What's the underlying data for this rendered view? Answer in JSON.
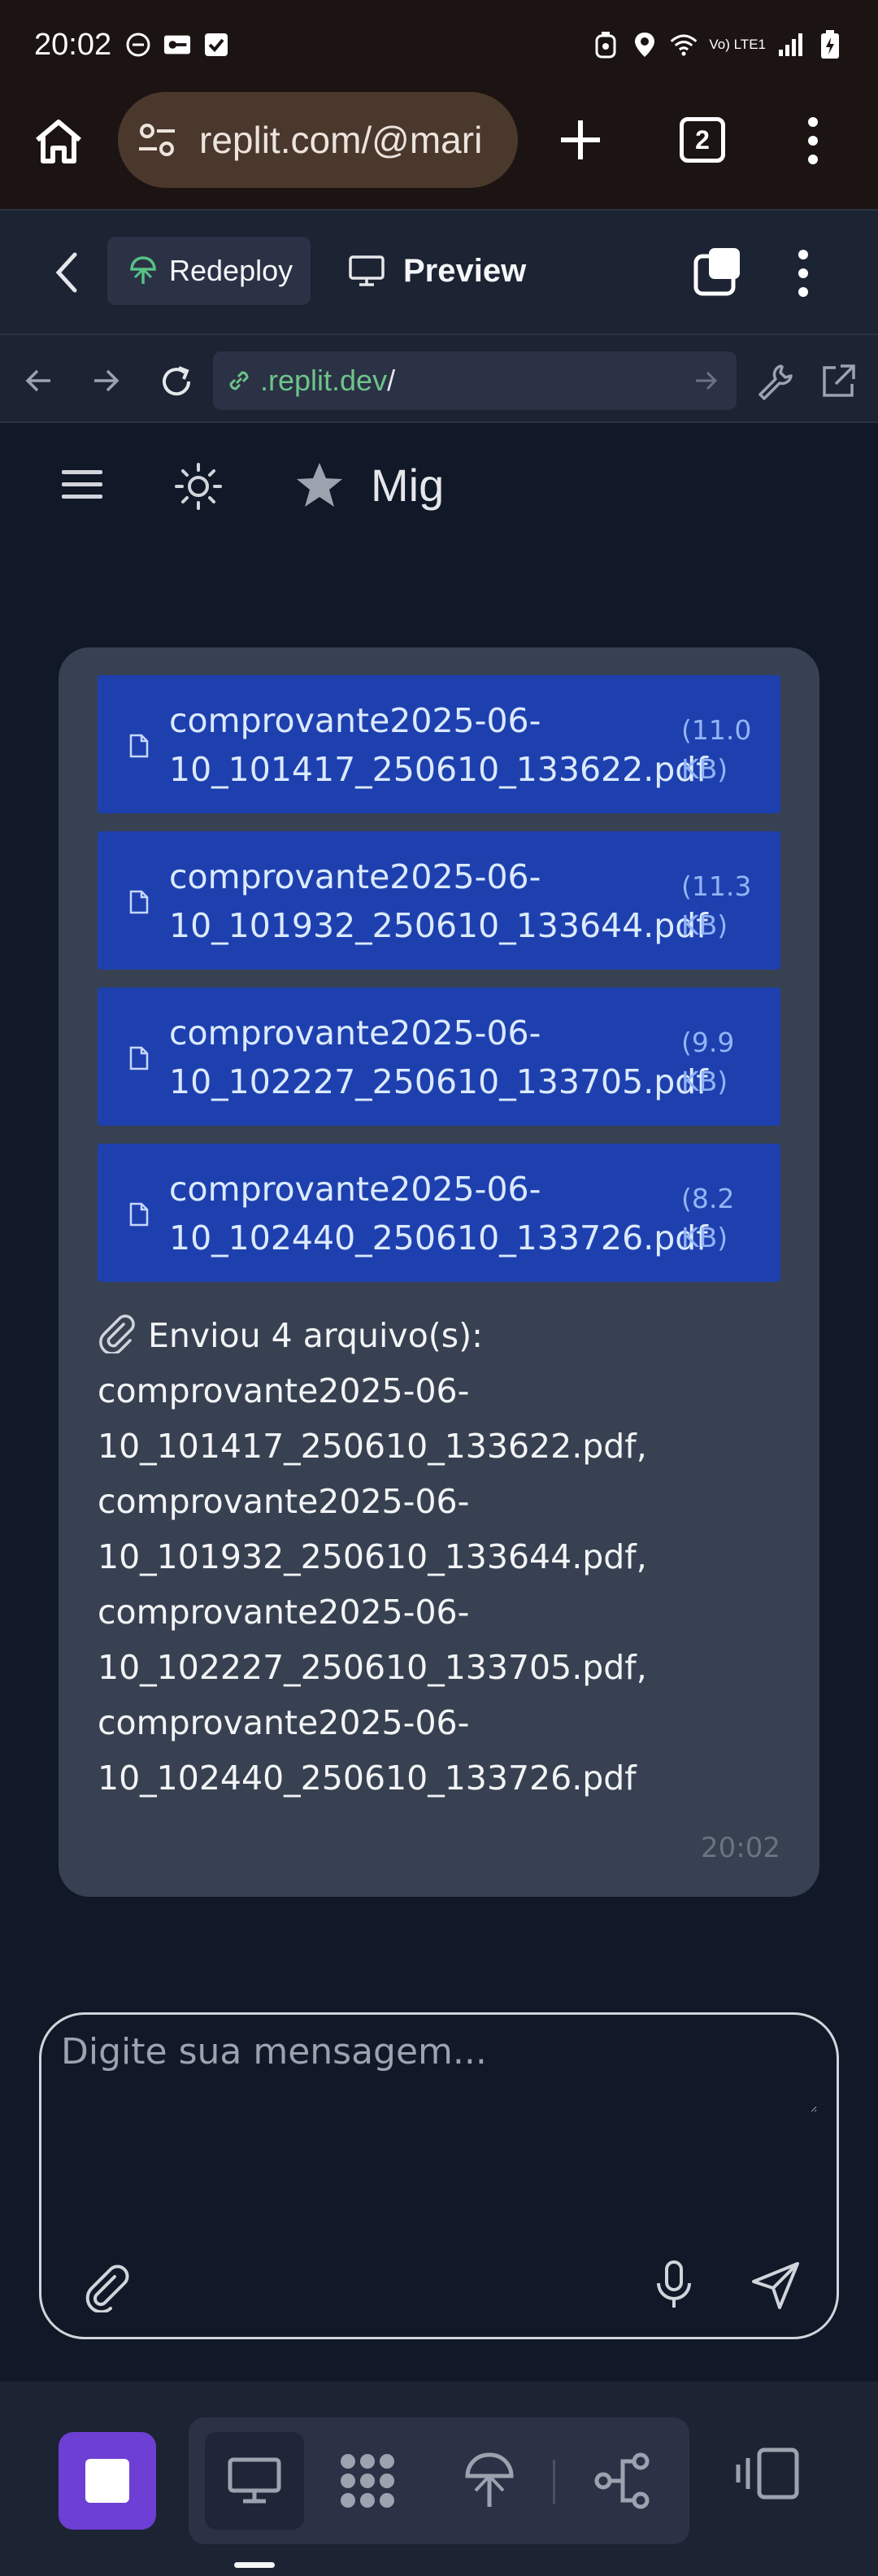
{
  "status_bar": {
    "time": "20:02",
    "network": "Vo) LTE1",
    "icons_left": [
      "dnd-icon",
      "key-icon",
      "check-icon"
    ],
    "icons_right": [
      "alarm-icon",
      "location-icon",
      "wifi-icon",
      "signal-icon",
      "battery-icon"
    ]
  },
  "browser": {
    "url": "replit.com/@mari",
    "tab_count": "2"
  },
  "replit_bar": {
    "redeploy_label": "Redeploy",
    "preview_label": "Preview"
  },
  "webview_nav": {
    "url_host": ".replit.dev",
    "url_path": "/"
  },
  "app_header": {
    "name": "Mig"
  },
  "message": {
    "attachments": [
      {
        "name": "comprovante2025-06-10_101417_250610_133622.pdf",
        "name_line1": "comprovante2025-06-",
        "name_line2": "10_101417_250610_133622.pdf",
        "size_line1": "(11.0",
        "size_line2": "KB)"
      },
      {
        "name": "comprovante2025-06-10_101932_250610_133644.pdf",
        "name_line1": "comprovante2025-06-",
        "name_line2": "10_101932_250610_133644.pdf",
        "size_line1": "(11.3",
        "size_line2": "KB)"
      },
      {
        "name": "comprovante2025-06-10_102227_250610_133705.pdf",
        "name_line1": "comprovante2025-06-",
        "name_line2": "10_102227_250610_133705.pdf",
        "size_line1": "(9.9",
        "size_line2": "KB)"
      },
      {
        "name": "comprovante2025-06-10_102440_250610_133726.pdf",
        "name_line1": "comprovante2025-06-",
        "name_line2": "10_102440_250610_133726.pdf",
        "size_line1": "(8.2",
        "size_line2": "KB)"
      }
    ],
    "text_lines": [
      "Enviou 4 arquivo(s):",
      "comprovante2025-06-",
      "10_101417_250610_133622.pdf,",
      "comprovante2025-06-",
      "10_101932_250610_133644.pdf,",
      "comprovante2025-06-",
      "10_102227_250610_133705.pdf,",
      "comprovante2025-06-",
      "10_102440_250610_133726.pdf"
    ],
    "time": "20:02"
  },
  "composer": {
    "placeholder": "Digite sua mensagem..."
  },
  "colors": {
    "page_bg": "#111827",
    "bubble_bg": "#374151",
    "file_card_bg": "#1e40af",
    "accent_purple": "#6d3fd4",
    "url_host_green": "#6dc48a"
  }
}
